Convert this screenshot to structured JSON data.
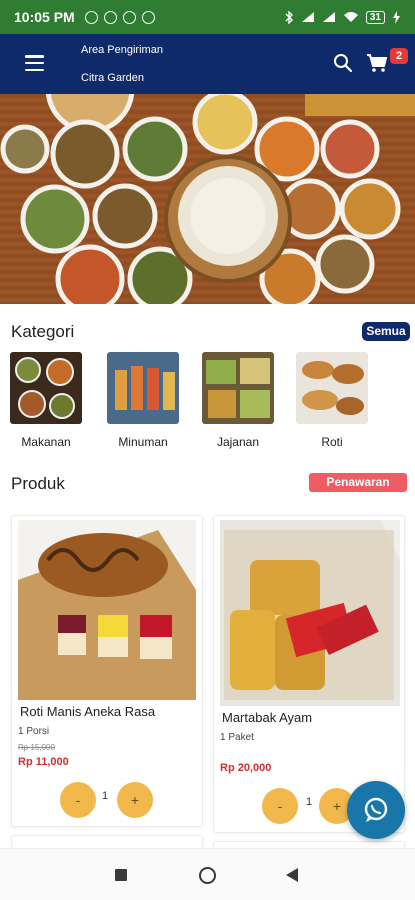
{
  "status_bar": {
    "time": "10:05 PM",
    "battery": "31"
  },
  "header": {
    "area_label": "Area Pengiriman",
    "area_value": "Citra Garden",
    "cart_count": "2"
  },
  "categories": {
    "title": "Kategori",
    "all_label": "Semua",
    "items": [
      {
        "label": "Makanan"
      },
      {
        "label": "Minuman"
      },
      {
        "label": "Jajanan"
      },
      {
        "label": "Roti"
      }
    ]
  },
  "products": {
    "title": "Produk",
    "offer_label": "Penawaran",
    "items": [
      {
        "name": "Roti Manis Aneka Rasa",
        "unit": "1 Porsi",
        "old_price": "Rp 15,000",
        "price": "Rp 11,000",
        "qty": "1",
        "minus": "-",
        "plus": "+"
      },
      {
        "name": "Martabak Ayam",
        "unit": "1 Paket",
        "price": "Rp 20,000",
        "qty": "1",
        "minus": "-",
        "plus": "+"
      }
    ]
  },
  "colors": {
    "status": "#2e7d32",
    "appbar": "#0f2a6b",
    "accent": "#f2b84b",
    "price": "#d32f2f",
    "offer": "#ef5c64",
    "fab": "#1877a8"
  },
  "icons": [
    "menu-icon",
    "search-icon",
    "cart-icon",
    "whatsapp-icon",
    "nav-recents-icon",
    "nav-home-icon",
    "nav-back-icon"
  ]
}
